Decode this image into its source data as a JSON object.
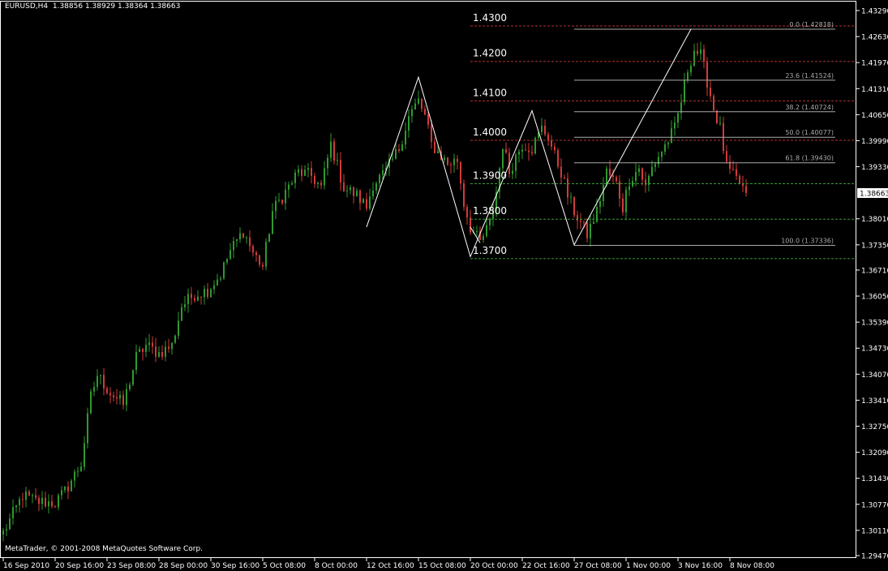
{
  "header": {
    "symbol": "EURUSD,H4",
    "ohlc": "1.38856 1.38929 1.38364 1.38663"
  },
  "copyright": "MetaTrader, © 2001-2008 MetaQuotes Software Corp.",
  "colors": {
    "background": "#000000",
    "bull": "#2e9a2e",
    "bear": "#d33a3a",
    "axis": "#ffffff",
    "pattern_line": "#ffffff",
    "fib_line": "#aaaaaa",
    "red_level": "#b03030",
    "green_level": "#3a9a3a"
  },
  "chart_data": {
    "type": "candlestick",
    "y_axis_ticks": [
      "1.43290",
      "1.42630",
      "1.41970",
      "1.41310",
      "1.40650",
      "1.39990",
      "1.39330",
      "1.38663",
      "1.38010",
      "1.37350",
      "1.36710",
      "1.36050",
      "1.35390",
      "1.34730",
      "1.34070",
      "1.33410",
      "1.32750",
      "1.32090",
      "1.31430",
      "1.30770",
      "1.30110",
      "1.29470"
    ],
    "y_axis_values": [
      1.4329,
      1.4263,
      1.4197,
      1.4131,
      1.4065,
      1.3999,
      1.3933,
      1.38663,
      1.3801,
      1.3735,
      1.3671,
      1.3605,
      1.3539,
      1.3473,
      1.3407,
      1.3341,
      1.3275,
      1.3209,
      1.3143,
      1.3077,
      1.3011,
      1.2947
    ],
    "current_price": "1.38663",
    "ylim": [
      1.2947,
      1.4329
    ],
    "x_axis_labels": [
      "16 Sep 2010",
      "20 Sep 16:00",
      "23 Sep 08:00",
      "28 Sep 00:00",
      "30 Sep 16:00",
      "5 Oct 08:00",
      "8 Oct 00:00",
      "12 Oct 16:00",
      "15 Oct 08:00",
      "20 Oct 00:00",
      "22 Oct 16:00",
      "27 Oct 08:00",
      "1 Nov 00:00",
      "3 Nov 16:00",
      "8 Nov 08:00"
    ],
    "x_axis_index": [
      0,
      16,
      32,
      48,
      64,
      80,
      96,
      112,
      128,
      144,
      160,
      176,
      192,
      208,
      224
    ],
    "bars_total": 230,
    "anchors": [
      [
        0,
        1.3005
      ],
      [
        6,
        1.31
      ],
      [
        10,
        1.3085
      ],
      [
        16,
        1.308
      ],
      [
        19,
        1.311
      ],
      [
        24,
        1.318
      ],
      [
        27,
        1.335
      ],
      [
        29,
        1.3405
      ],
      [
        33,
        1.336
      ],
      [
        37,
        1.333
      ],
      [
        41,
        1.345
      ],
      [
        44,
        1.348
      ],
      [
        48,
        1.346
      ],
      [
        52,
        1.348
      ],
      [
        55,
        1.358
      ],
      [
        59,
        1.361
      ],
      [
        63,
        1.362
      ],
      [
        67,
        1.366
      ],
      [
        70,
        1.372
      ],
      [
        74,
        1.377
      ],
      [
        77,
        1.3715
      ],
      [
        80,
        1.368
      ],
      [
        83,
        1.382
      ],
      [
        87,
        1.387
      ],
      [
        91,
        1.392
      ],
      [
        95,
        1.391
      ],
      [
        98,
        1.388
      ],
      [
        101,
        1.399
      ],
      [
        105,
        1.388
      ],
      [
        109,
        1.386
      ],
      [
        112,
        1.383
      ],
      [
        114,
        1.389
      ],
      [
        118,
        1.392
      ],
      [
        122,
        1.398
      ],
      [
        125,
        1.406
      ],
      [
        128,
        1.41
      ],
      [
        130,
        1.406
      ],
      [
        132,
        1.399
      ],
      [
        135,
        1.396
      ],
      [
        137,
        1.394
      ],
      [
        140,
        1.395
      ],
      [
        142,
        1.384
      ],
      [
        144,
        1.378
      ],
      [
        147,
        1.374
      ],
      [
        150,
        1.379
      ],
      [
        152,
        1.387
      ],
      [
        154,
        1.399
      ],
      [
        156,
        1.392
      ],
      [
        158,
        1.396
      ],
      [
        160,
        1.399
      ],
      [
        163,
        1.398
      ],
      [
        166,
        1.403
      ],
      [
        168,
        1.401
      ],
      [
        170,
        1.396
      ],
      [
        172,
        1.392
      ],
      [
        174,
        1.386
      ],
      [
        176,
        1.382
      ],
      [
        178,
        1.379
      ],
      [
        180,
        1.376
      ],
      [
        183,
        1.382
      ],
      [
        186,
        1.392
      ],
      [
        189,
        1.389
      ],
      [
        191,
        1.383
      ],
      [
        193,
        1.39
      ],
      [
        196,
        1.393
      ],
      [
        198,
        1.388
      ],
      [
        200,
        1.393
      ],
      [
        202,
        1.396
      ],
      [
        205,
        1.4
      ],
      [
        207,
        1.403
      ],
      [
        209,
        1.41
      ],
      [
        211,
        1.418
      ],
      [
        213,
        1.423
      ],
      [
        215,
        1.4215
      ],
      [
        217,
        1.415
      ],
      [
        219,
        1.408
      ],
      [
        221,
        1.403
      ],
      [
        223,
        1.393
      ],
      [
        225,
        1.391
      ],
      [
        227,
        1.389
      ],
      [
        229,
        1.38663
      ]
    ],
    "pattern_lines": [
      [
        [
          144,
          1.378
        ],
        [
          147,
          1.374
        ]
      ],
      [
        [
          112,
          1.378
        ],
        [
          128,
          1.416
        ],
        [
          144,
          1.3705
        ],
        [
          163,
          1.4075
        ],
        [
          176,
          1.3735
        ],
        [
          212,
          1.4282
        ]
      ]
    ],
    "pattern_levels": [
      {
        "label": "1.4300",
        "value": 1.429,
        "color": "red"
      },
      {
        "label": "1.4200",
        "value": 1.42,
        "color": "red"
      },
      {
        "label": "1.4100",
        "value": 1.41,
        "color": "red"
      },
      {
        "label": "1.4000",
        "value": 1.4,
        "color": "red"
      },
      {
        "label": "1.3900",
        "value": 1.389,
        "color": "green"
      },
      {
        "label": "1.3800",
        "value": 1.38,
        "color": "green"
      },
      {
        "label": "1.3700",
        "value": 1.37,
        "color": "green"
      }
    ],
    "fib_levels": [
      {
        "label": "0.0 (1.42818)",
        "value": 1.42818
      },
      {
        "label": "23.6 (1.41524)",
        "value": 1.41524
      },
      {
        "label": "38.2 (1.40724)",
        "value": 1.40724
      },
      {
        "label": "50.0 (1.40077)",
        "value": 1.40077
      },
      {
        "label": "61.8 (1.39430)",
        "value": 1.3943
      },
      {
        "label": "100.0 (1.37336)",
        "value": 1.37336
      }
    ],
    "fib_start_index": 176,
    "pattern_start_index": 144
  }
}
